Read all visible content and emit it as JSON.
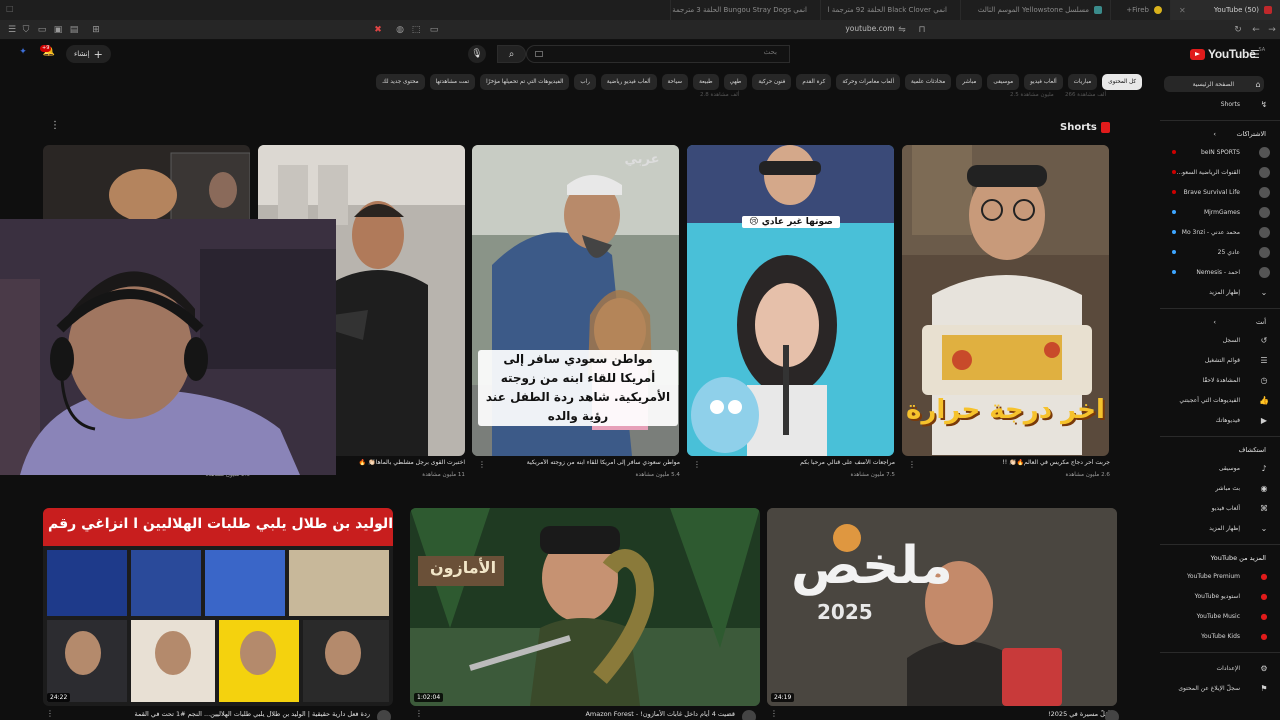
{
  "browser": {
    "tabs": [
      {
        "label": "(50) YouTube",
        "active": true
      },
      {
        "label": "Fireb+",
        "active": false
      },
      {
        "label": "مسلسل Yellowstone الموسم الثالث",
        "active": false
      },
      {
        "label": "انمي Black Clover الحلقة 92 مترجمة ا",
        "active": false
      },
      {
        "label": "انمي Bungou Stray Dogs الحلقة 3 مترجمة",
        "active": false
      }
    ],
    "url": "youtube.com"
  },
  "header": {
    "logo_text": "YouTube",
    "logo_country": "SA",
    "search_placeholder": "بحث",
    "create_label": "إنشاء",
    "notifications_count": "+9"
  },
  "chips": [
    "كل المحتوى",
    "مباريات",
    "ألعاب فيديو",
    "موسيقى",
    "مباشر",
    "محادثات علمية",
    "ألعاب مغامرات وحركة",
    "كرة القدم",
    "فنون حركية",
    "طهي",
    "طبيعة",
    "سياحة",
    "ألعاب فيديو رياضية",
    "راب",
    "الفيديوهات التي تم تحميلها مؤخرًا",
    "تمت مشاهدتها",
    "محتوى جديد لك"
  ],
  "sidebar": {
    "main": [
      {
        "label": "الصفحة الرئيسية",
        "icon": "home-icon",
        "active": true
      },
      {
        "label": "Shorts",
        "icon": "shorts-icon"
      }
    ],
    "subscriptions_title": "الاشتراكات",
    "subscriptions": [
      {
        "label": "beIN SPORTS",
        "live": true
      },
      {
        "label": "القنوات الرياضية السعو...",
        "live": true
      },
      {
        "label": "Brave Survival Life",
        "live": true
      },
      {
        "label": "MjrmGames",
        "live": false
      },
      {
        "label": "محمد عدني - Mo 3nzi",
        "live": false
      },
      {
        "label": "عادي 25",
        "live": false
      },
      {
        "label": "احمد - Nemesis",
        "live": false
      }
    ],
    "show_more": "إظهار المزيد",
    "you_title": "أنت",
    "you": [
      {
        "label": "السجل",
        "icon": "history-icon"
      },
      {
        "label": "قوائم التشغيل",
        "icon": "playlist-icon"
      },
      {
        "label": "المشاهدة لاحقًا",
        "icon": "clock-icon"
      },
      {
        "label": "الفيديوهات التي أعجبتني",
        "icon": "like-icon"
      },
      {
        "label": "فيديوهاتك",
        "icon": "video-icon"
      }
    ],
    "explore_title": "استكشاف",
    "explore": [
      {
        "label": "موسيقى",
        "icon": "music-icon"
      },
      {
        "label": "بث مباشر",
        "icon": "live-icon"
      },
      {
        "label": "ألعاب فيديو",
        "icon": "gaming-icon"
      },
      {
        "label": "إظهار المزيد",
        "icon": "chevron-down-icon"
      }
    ],
    "more_title": "المزيد من YouTube",
    "more": [
      {
        "label": "YouTube Premium"
      },
      {
        "label": "استوديو YouTube"
      },
      {
        "label": "YouTube Music"
      },
      {
        "label": "YouTube Kids"
      }
    ],
    "bottom": [
      {
        "label": "الإعدادات",
        "icon": "gear-icon"
      },
      {
        "label": "سجلّ الإبلاغ عن المحتوى",
        "icon": "flag-icon"
      }
    ]
  },
  "shorts": {
    "title": "Shorts",
    "items": [
      {
        "caption": "جربت أحر دجاج مكريس في العالم🔥👏🏻 !!",
        "views": "2.6 مليون مشاهدة",
        "overlay": "اخر درجة حرارة"
      },
      {
        "caption": "مراجعات الأسف على قنالي مرحبا بكم",
        "views": "7.5 مليون مشاهدة",
        "overlay": "صوتها غير عادي 😢"
      },
      {
        "caption": "مواطن سعودي سافر إلى أمريكا للقاء ابنه من زوجته الأمريكية",
        "views": "5.4 مليون مشاهدة",
        "overlay": "مواطن سعودي سافر إلى أمريكا للقاء ابنه من زوجته الأمريكية. شاهد ردة الطفل عند رؤية والده"
      },
      {
        "caption": "اختبرت القوى برجل مشلطي بالماها👏🏻 🔥",
        "views": "11 مليون مشاهدة",
        "overlay": ""
      },
      {
        "caption": "",
        "views": "2.3 مليون مشاهدة",
        "overlay": ""
      }
    ]
  },
  "videos": [
    {
      "title": "أقلّ مسيرة في 2025!",
      "duration": "24:19",
      "overlay": "ملخص",
      "overlay2": "2025"
    },
    {
      "title": "قضيت 4 أيام داخل غابات الأمازون! - Amazon Forest",
      "duration": "1:02:04",
      "overlay": "الأمازون"
    },
    {
      "title": "ردة فعل دارية حقيقية | الوليد بن طلال يلبي طلبات الهلاليين... النجم #1 تحت في القمة",
      "duration": "24:22",
      "overlay": "الوليد بن طلال يلبي طلبات الهلاليين ا انزاغي رقم ١"
    }
  ],
  "faded_views": [
    "266 ألف مشاهدة",
    "2.5 مليون مشاهدة",
    "2.8 ألف مشاهدة"
  ]
}
